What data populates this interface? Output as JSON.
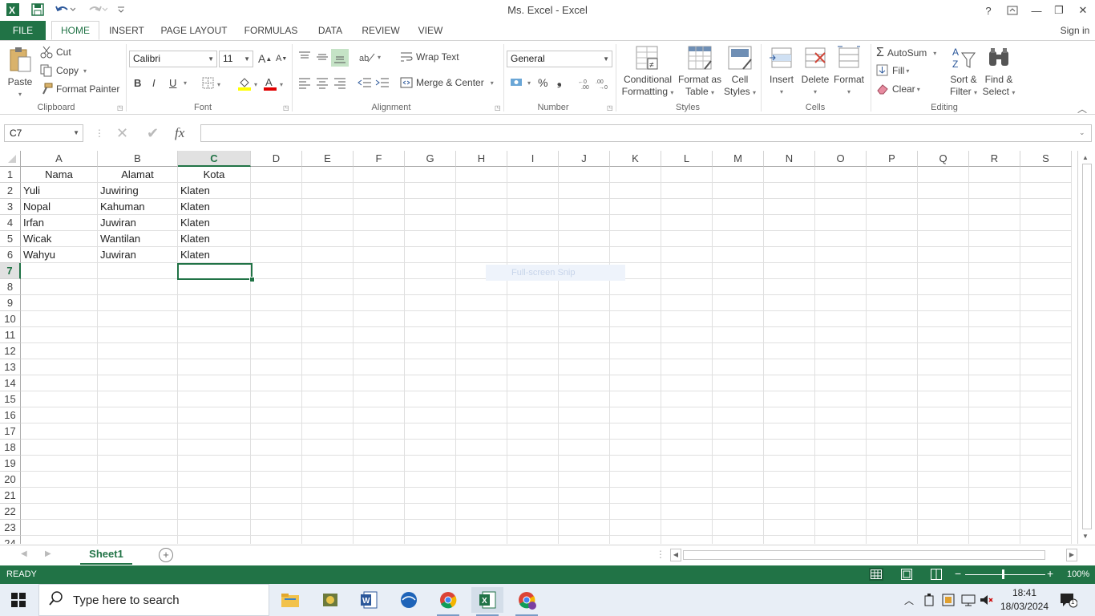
{
  "window": {
    "title": "Ms. Excel - Excel"
  },
  "titlebar": {
    "help": "?",
    "minimize": "—",
    "restore": "❐",
    "close": "✕"
  },
  "tabs": [
    "FILE",
    "HOME",
    "INSERT",
    "PAGE LAYOUT",
    "FORMULAS",
    "DATA",
    "REVIEW",
    "VIEW"
  ],
  "sign_in": "Sign in",
  "ribbon": {
    "clipboard": {
      "paste": "Paste",
      "cut": "Cut",
      "copy": "Copy",
      "format_painter": "Format Painter",
      "label": "Clipboard"
    },
    "font": {
      "name": "Calibri",
      "size": "11",
      "bold": "B",
      "italic": "I",
      "underline": "U",
      "grow": "A",
      "shrink": "A",
      "label": "Font"
    },
    "alignment": {
      "wrap": "Wrap Text",
      "merge": "Merge & Center",
      "label": "Alignment"
    },
    "number": {
      "format": "General",
      "percent": "%",
      "comma": "❟",
      "label": "Number"
    },
    "styles": {
      "conditional": [
        "Conditional",
        "Formatting"
      ],
      "format_table": [
        "Format as",
        "Table"
      ],
      "cell_styles": [
        "Cell",
        "Styles"
      ],
      "label": "Styles"
    },
    "cells": {
      "insert": "Insert",
      "delete": "Delete",
      "format": "Format",
      "label": "Cells"
    },
    "editing": {
      "autosum": "AutoSum",
      "fill": "Fill",
      "clear": "Clear",
      "sort": [
        "Sort &",
        "Filter"
      ],
      "find": [
        "Find &",
        "Select"
      ],
      "label": "Editing"
    }
  },
  "formula_bar": {
    "name_box": "C7",
    "fx": "fx",
    "value": ""
  },
  "columns": [
    "A",
    "B",
    "C",
    "D",
    "E",
    "F",
    "G",
    "H",
    "I",
    "J",
    "K",
    "L",
    "M",
    "N",
    "O",
    "P",
    "Q",
    "R",
    "S"
  ],
  "rows": [
    "1",
    "2",
    "3",
    "4",
    "5",
    "6",
    "7",
    "8",
    "9",
    "10",
    "11",
    "12",
    "13",
    "14",
    "15",
    "16",
    "17",
    "18",
    "19",
    "20",
    "21",
    "22",
    "23",
    "24"
  ],
  "table": {
    "headers": [
      "Nama",
      "Alamat",
      "Kota"
    ],
    "data": [
      [
        "Yuli",
        "Juwiring",
        "Klaten"
      ],
      [
        "Nopal",
        "Kahuman",
        "Klaten"
      ],
      [
        "Irfan",
        "Juwiran",
        "Klaten"
      ],
      [
        "Wicak",
        "Wantilan",
        "Klaten"
      ],
      [
        "Wahyu",
        "Juwiran",
        "Klaten"
      ]
    ]
  },
  "overlay": {
    "snip": "Full-screen Snip"
  },
  "sheets": {
    "active": "Sheet1",
    "add": "+"
  },
  "status": {
    "mode": "READY",
    "zoom": "100%"
  },
  "taskbar": {
    "search_placeholder": "Type here to search",
    "time": "18:41",
    "date": "18/03/2024",
    "notifications": "1"
  },
  "colors": {
    "excel_green": "#217346",
    "taskbar": "#e8eef6"
  }
}
